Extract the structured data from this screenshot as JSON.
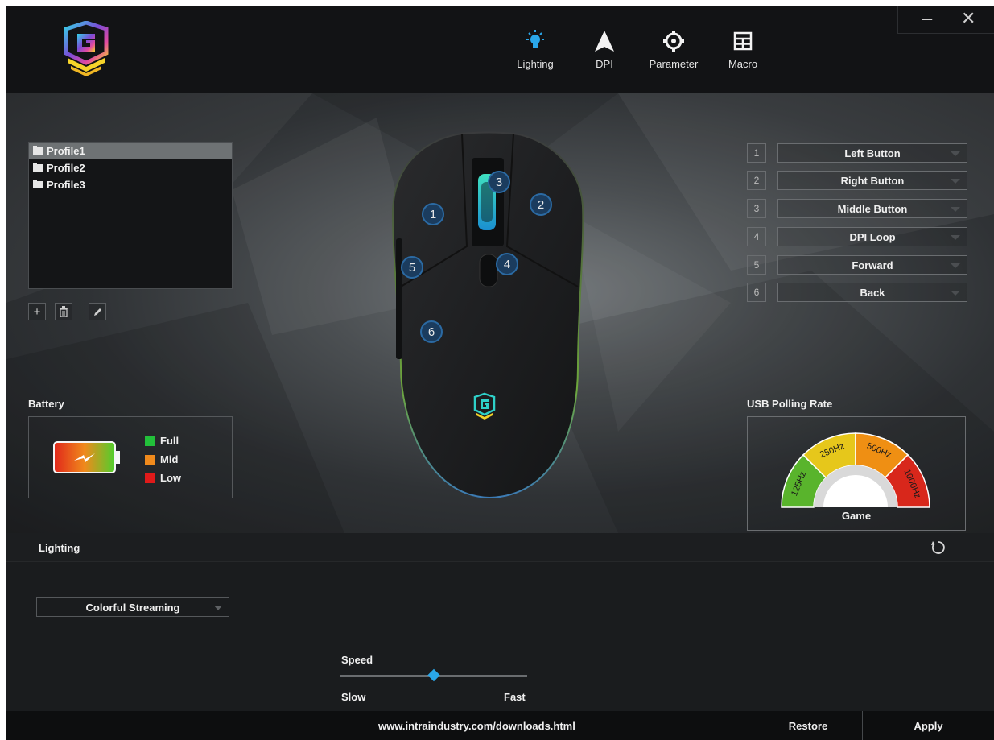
{
  "window": {
    "minimize_symbol": "–",
    "close_symbol": "✕"
  },
  "nav": {
    "tabs": [
      {
        "label": "Lighting",
        "icon": "bulb-icon",
        "active": true
      },
      {
        "label": "DPI",
        "icon": "arrow-up-icon"
      },
      {
        "label": "Parameter",
        "icon": "gear-icon"
      },
      {
        "label": "Macro",
        "icon": "grid-icon"
      }
    ]
  },
  "profiles": {
    "items": [
      "Profile1",
      "Profile2",
      "Profile3"
    ],
    "selected": "Profile1",
    "tools": {
      "add_symbol": "+"
    }
  },
  "battery": {
    "title": "Battery",
    "legend": [
      {
        "label": "Full",
        "color": "#22c03a"
      },
      {
        "label": "Mid",
        "color": "#f08a1c"
      },
      {
        "label": "Low",
        "color": "#e01a1a"
      }
    ]
  },
  "mouse": {
    "badges": [
      "1",
      "2",
      "3",
      "4",
      "5",
      "6"
    ]
  },
  "assignments": [
    {
      "num": "1",
      "value": "Left Button"
    },
    {
      "num": "2",
      "value": "Right Button"
    },
    {
      "num": "3",
      "value": "Middle Button"
    },
    {
      "num": "4",
      "value": "DPI Loop"
    },
    {
      "num": "5",
      "value": "Forward"
    },
    {
      "num": "6",
      "value": "Back"
    }
  ],
  "polling": {
    "title": "USB Polling Rate",
    "rates": [
      "125Hz",
      "250Hz",
      "500Hz",
      "1000Hz"
    ],
    "rate_colors": [
      "#59b42c",
      "#e6c71b",
      "#ef8f13",
      "#d8271b"
    ],
    "mode": "Game"
  },
  "lighting": {
    "title": "Lighting",
    "effect": "Colorful Streaming",
    "speed_label": "Speed",
    "speed_min": "Slow",
    "speed_max": "Fast",
    "speed_value": 0.5
  },
  "footer": {
    "url": "www.intraindustry.com/downloads.html",
    "restore": "Restore",
    "apply": "Apply"
  },
  "colors": {
    "accent": "#2aa7ea",
    "badge_ring": "#2b6aa3"
  }
}
